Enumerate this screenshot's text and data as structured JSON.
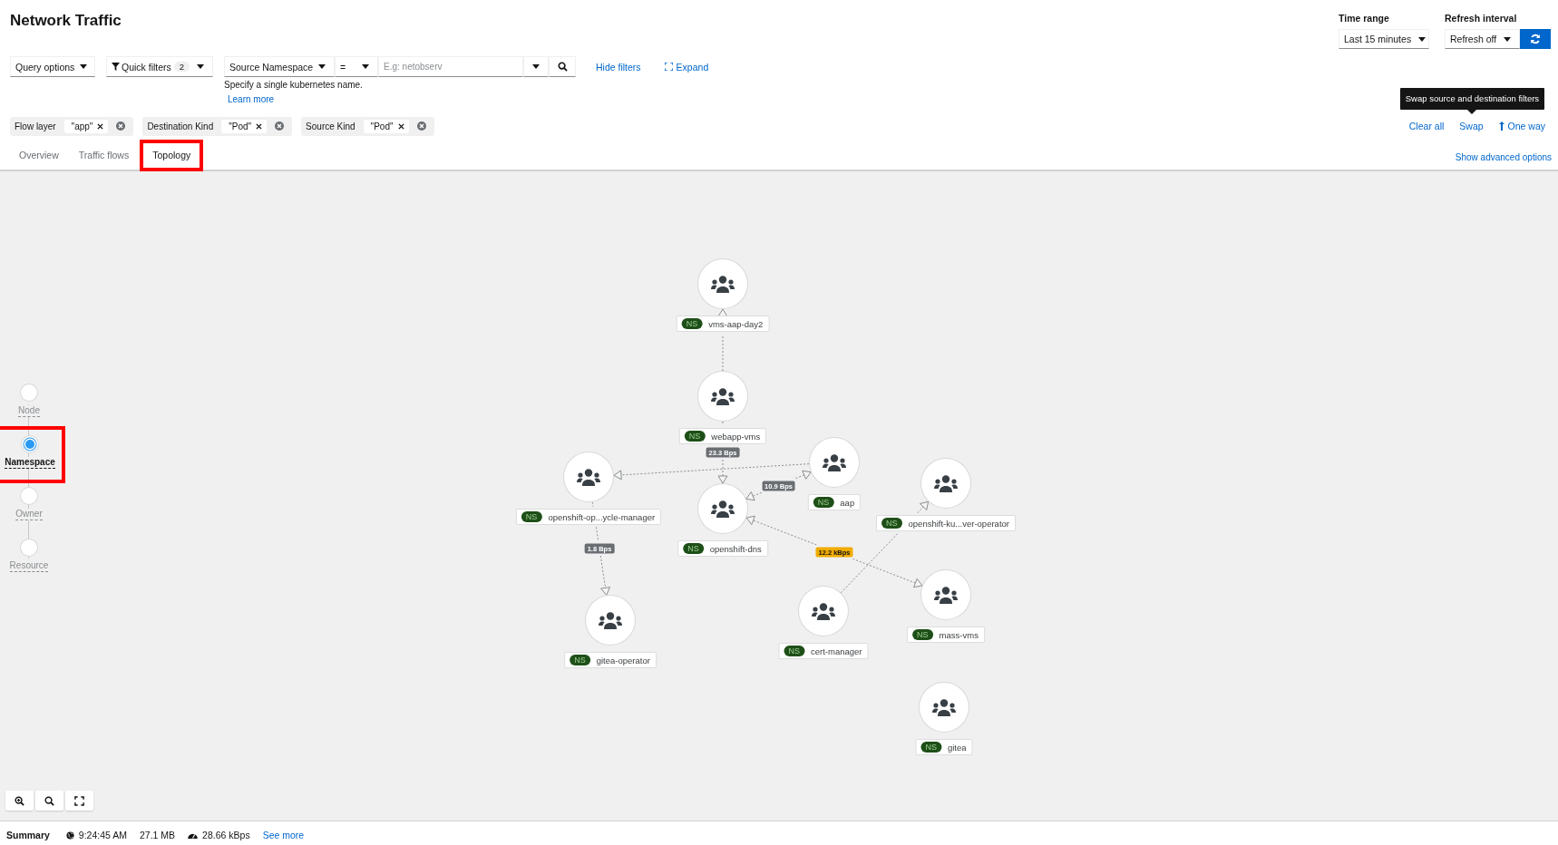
{
  "page": {
    "title": "Network Traffic"
  },
  "time_range": {
    "label": "Time range",
    "value": "Last 15 minutes"
  },
  "refresh_interval": {
    "label": "Refresh interval",
    "value": "Refresh off"
  },
  "toolbar": {
    "query_options": "Query options",
    "quick_filters": {
      "label": "Quick filters",
      "count": "2"
    },
    "filter_field": "Source Namespace",
    "comparator": "=",
    "search_placeholder": "E.g: netobserv",
    "hint": "Specify a single kubernetes name.",
    "learn_more": "Learn more",
    "hide_filters": "Hide filters",
    "expand": "Expand"
  },
  "filter_chips": [
    {
      "category": "Flow layer",
      "value": "\"app\""
    },
    {
      "category": "Destination Kind",
      "value": "\"Pod\""
    },
    {
      "category": "Source Kind",
      "value": "\"Pod\""
    }
  ],
  "filter_actions": {
    "clear_all": "Clear all",
    "swap": "Swap",
    "one_way": "One way",
    "tooltip": "Swap source and destination filters"
  },
  "tabs": [
    {
      "label": "Overview",
      "selected": false,
      "highlighted": false
    },
    {
      "label": "Traffic flows",
      "selected": false,
      "highlighted": false
    },
    {
      "label": "Topology",
      "selected": true,
      "highlighted": true
    }
  ],
  "advanced_options": "Show advanced options",
  "scopes": [
    {
      "label": "Node",
      "selected": false,
      "highlighted": false
    },
    {
      "label": "Namespace",
      "selected": true,
      "highlighted": true
    },
    {
      "label": "Owner",
      "selected": false,
      "highlighted": false
    },
    {
      "label": "Resource",
      "selected": false,
      "highlighted": false
    }
  ],
  "nodes": [
    {
      "badge": "NS",
      "name": "vms-aap-day2"
    },
    {
      "badge": "NS",
      "name": "webapp-vms"
    },
    {
      "badge": "NS",
      "name": "openshift-op...ycle-manager"
    },
    {
      "badge": "NS",
      "name": "aap"
    },
    {
      "badge": "NS",
      "name": "openshift-dns"
    },
    {
      "badge": "NS",
      "name": "openshift-ku...ver-operator"
    },
    {
      "badge": "NS",
      "name": "gitea-operator"
    },
    {
      "badge": "NS",
      "name": "cert-manager"
    },
    {
      "badge": "NS",
      "name": "mass-vms"
    },
    {
      "badge": "NS",
      "name": "gitea"
    }
  ],
  "edges": [
    {
      "bidirectional": false
    },
    {
      "bidirectional": false,
      "label": "23.3 Bps",
      "warning": false
    },
    {
      "bidirectional": false
    },
    {
      "bidirectional": true,
      "label": "10.9 Bps",
      "warning": false
    },
    {
      "bidirectional": false,
      "label": "1.8 Bps",
      "warning": false
    },
    {
      "bidirectional": true,
      "label": "12.2 kBps",
      "warning": true
    },
    {
      "bidirectional": false
    }
  ],
  "summary": {
    "title": "Summary",
    "time": "9:24:45 AM",
    "size": "27.1 MB",
    "rate": "28.66 kBps",
    "see_more": "See more"
  }
}
